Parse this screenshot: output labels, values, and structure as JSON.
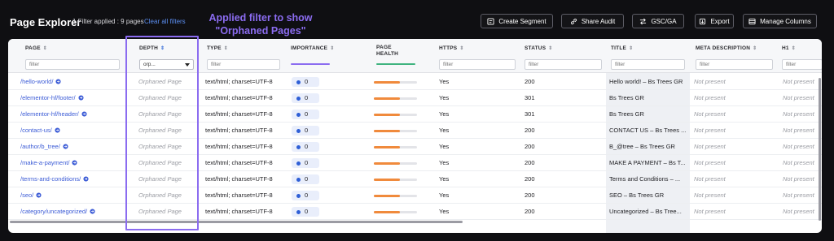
{
  "header": {
    "title": "Page Explorer",
    "filter_info": "1 Filter applied : 9 pages",
    "clear_link": "Clear all filters",
    "annotation_line1": "Applied filter to show",
    "annotation_line2": "\"Orphaned Pages\"",
    "buttons": {
      "create_segment": "Create Segment",
      "share_audit": "Share Audit",
      "gsc_ga": "GSC/GA",
      "export": "Export",
      "manage_columns": "Manage Columns"
    }
  },
  "columns": {
    "page": {
      "label": "PAGE",
      "filter_placeholder": "filter"
    },
    "depth": {
      "label": "DEPTH",
      "filter_value": "orp..."
    },
    "type": {
      "label": "TYPE",
      "filter_placeholder": "filter"
    },
    "importance": {
      "label": "IMPORTANCE"
    },
    "health": {
      "label_line1": "PAGE",
      "label_line2": "HEALTH"
    },
    "https": {
      "label": "HTTPS",
      "filter_placeholder": "filter"
    },
    "status": {
      "label": "STATUS",
      "filter_placeholder": "filter"
    },
    "title": {
      "label": "TITLE",
      "filter_placeholder": "filter"
    },
    "meta": {
      "label": "META DESCRIPTION",
      "filter_placeholder": "filter"
    },
    "h1": {
      "label": "H1",
      "filter_placeholder": "filter"
    }
  },
  "colors": {
    "accent": "#8b6cf0",
    "link": "#3b5bd6",
    "health_bar": "#f08a3c",
    "importance_dot": "#2f5fd6"
  },
  "rows": [
    {
      "page": "/hello-world/",
      "depth": "Orphaned Page",
      "type": "text/html; charset=UTF-8",
      "importance": "0",
      "health": 0.6,
      "https": "Yes",
      "status": "200",
      "title": "Hello world! – Bs Trees GR",
      "meta": "Not present",
      "h1": "Not present"
    },
    {
      "page": "/elementor-hf/footer/",
      "depth": "Orphaned Page",
      "type": "text/html; charset=UTF-8",
      "importance": "0",
      "health": 0.6,
      "https": "Yes",
      "status": "301",
      "title": "Bs Trees GR",
      "meta": "Not present",
      "h1": "Not present"
    },
    {
      "page": "/elementor-hf/header/",
      "depth": "Orphaned Page",
      "type": "text/html; charset=UTF-8",
      "importance": "0",
      "health": 0.6,
      "https": "Yes",
      "status": "301",
      "title": "Bs Trees GR",
      "meta": "Not present",
      "h1": "Not present"
    },
    {
      "page": "/contact-us/",
      "depth": "Orphaned Page",
      "type": "text/html; charset=UTF-8",
      "importance": "0",
      "health": 0.6,
      "https": "Yes",
      "status": "200",
      "title": "CONTACT US – Bs Trees ...",
      "meta": "Not present",
      "h1": "Not present"
    },
    {
      "page": "/author/b_tree/",
      "depth": "Orphaned Page",
      "type": "text/html; charset=UTF-8",
      "importance": "0",
      "health": 0.6,
      "https": "Yes",
      "status": "200",
      "title": "B_@tree – Bs Trees GR",
      "meta": "Not present",
      "h1": "Not present"
    },
    {
      "page": "/make-a-payment/",
      "depth": "Orphaned Page",
      "type": "text/html; charset=UTF-8",
      "importance": "0",
      "health": 0.6,
      "https": "Yes",
      "status": "200",
      "title": "MAKE A PAYMENT – Bs T...",
      "meta": "Not present",
      "h1": "Not present"
    },
    {
      "page": "/terms-and-conditions/",
      "depth": "Orphaned Page",
      "type": "text/html; charset=UTF-8",
      "importance": "0",
      "health": 0.6,
      "https": "Yes",
      "status": "200",
      "title": "Terms and Conditions – ...",
      "meta": "Not present",
      "h1": "Not present"
    },
    {
      "page": "/seo/",
      "depth": "Orphaned Page",
      "type": "text/html; charset=UTF-8",
      "importance": "0",
      "health": 0.6,
      "https": "Yes",
      "status": "200",
      "title": "SEO – Bs Trees GR",
      "meta": "Not present",
      "h1": "Not present"
    },
    {
      "page": "/category/uncategorized/",
      "depth": "Orphaned Page",
      "type": "text/html; charset=UTF-8",
      "importance": "0",
      "health": 0.6,
      "https": "Yes",
      "status": "200",
      "title": "Uncategorized – Bs Tree...",
      "meta": "Not present",
      "h1": "Not present"
    }
  ]
}
